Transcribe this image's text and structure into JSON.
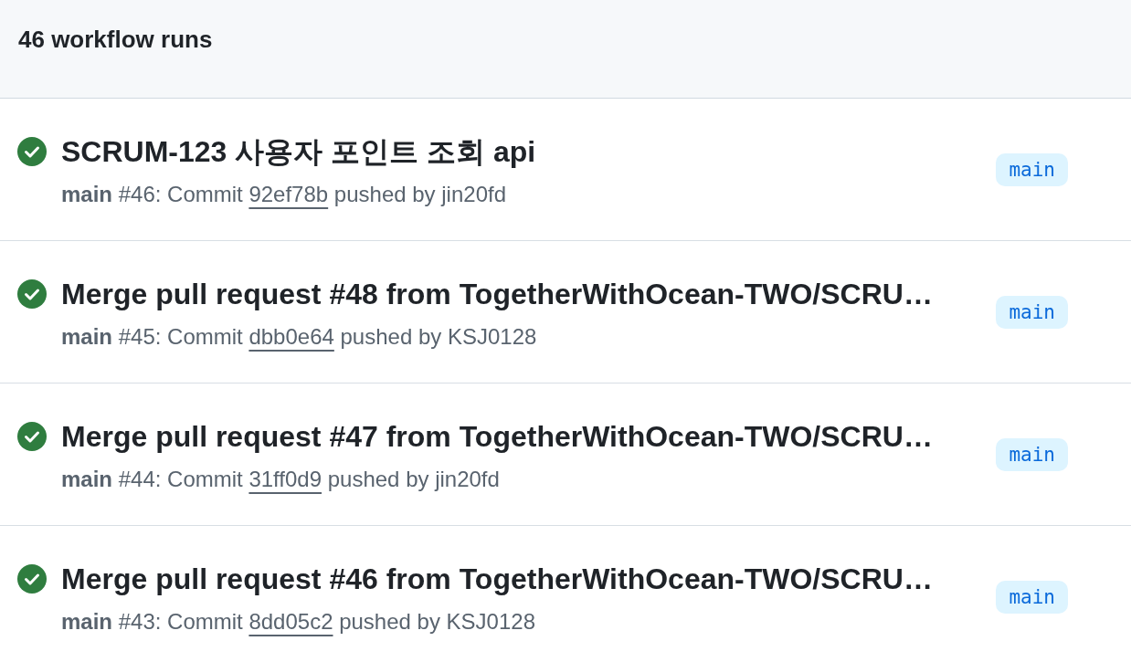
{
  "header": {
    "title": "46 workflow runs"
  },
  "runs": [
    {
      "succeeded": true,
      "title": "SCRUM-123 사용자 포인트 조회 api",
      "branch": "main",
      "summary": "#46: Commit",
      "commit": "92ef78b",
      "pusher": "pushed by jin20fd",
      "branch_badge": "main"
    },
    {
      "succeeded": true,
      "title": "Merge pull request #48 from TogetherWithOcean-TWO/SCRU…",
      "branch": "main",
      "summary": "#45: Commit",
      "commit": "dbb0e64",
      "pusher": "pushed by KSJ0128",
      "branch_badge": "main"
    },
    {
      "succeeded": true,
      "title": "Merge pull request #47 from TogetherWithOcean-TWO/SCRU…",
      "branch": "main",
      "summary": "#44: Commit",
      "commit": "31ff0d9",
      "pusher": "pushed by jin20fd",
      "branch_badge": "main"
    },
    {
      "succeeded": true,
      "title": "Merge pull request #46 from TogetherWithOcean-TWO/SCRU…",
      "branch": "main",
      "summary": "#43: Commit",
      "commit": "8dd05c2",
      "pusher": "pushed by KSJ0128",
      "branch_badge": "main"
    }
  ]
}
